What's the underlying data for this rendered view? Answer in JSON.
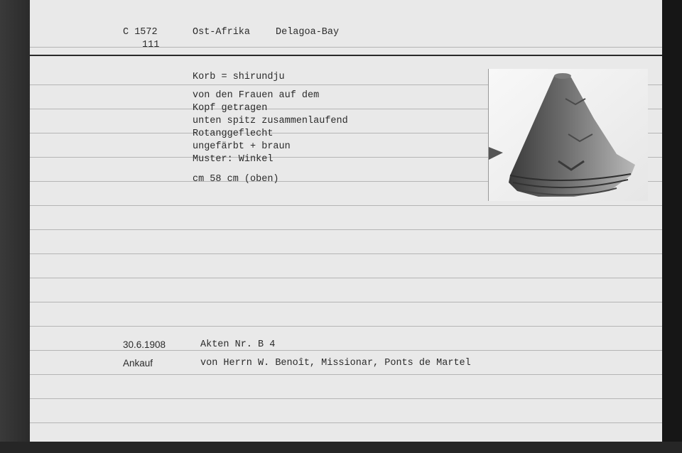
{
  "header": {
    "catalog_number": "C 1572",
    "sub_number": "111",
    "region": "Ost-Afrika",
    "locality": "Delagoa-Bay"
  },
  "description": {
    "object_name": "Korb = shirundju",
    "lines": [
      "von den Frauen auf dem",
      "Kopf getragen",
      "unten spitz zusammenlaufend",
      "Rotanggeflecht",
      "ungefärbt + braun",
      "Muster: Winkel"
    ],
    "dimension": "cm 58 cm (oben)"
  },
  "acquisition": {
    "date": "30.6.1908",
    "file_ref": "Akten Nr. B 4",
    "type": "Ankauf",
    "source": "von Herrn W. Benoît, Missionar, Ponts de Martel"
  }
}
